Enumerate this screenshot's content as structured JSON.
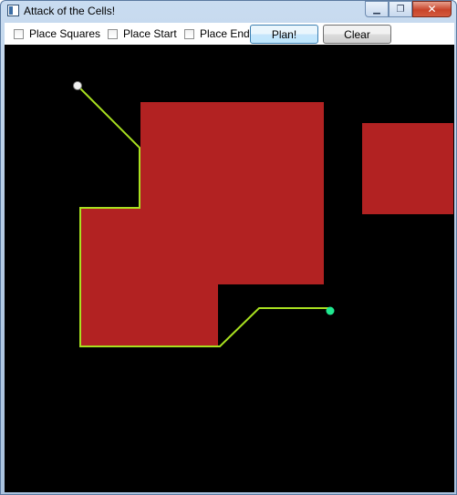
{
  "window": {
    "title": "Attack of the Cells!",
    "minimize_glyph": "▁",
    "maximize_glyph": "❐",
    "close_glyph": "✕"
  },
  "toolbar": {
    "place_squares_label": "Place Squares",
    "place_squares_checked": false,
    "place_start_label": "Place Start",
    "place_start_checked": false,
    "place_end_label": "Place End",
    "place_end_checked": false,
    "plan_label": "Plan!",
    "clear_label": "Clear"
  },
  "canvas": {
    "background_color": "#000000",
    "obstacle_color": "#b22222",
    "path_color": "#a8e020",
    "start_marker_color": "#f0f0f0",
    "end_marker_color": "#20e890"
  }
}
